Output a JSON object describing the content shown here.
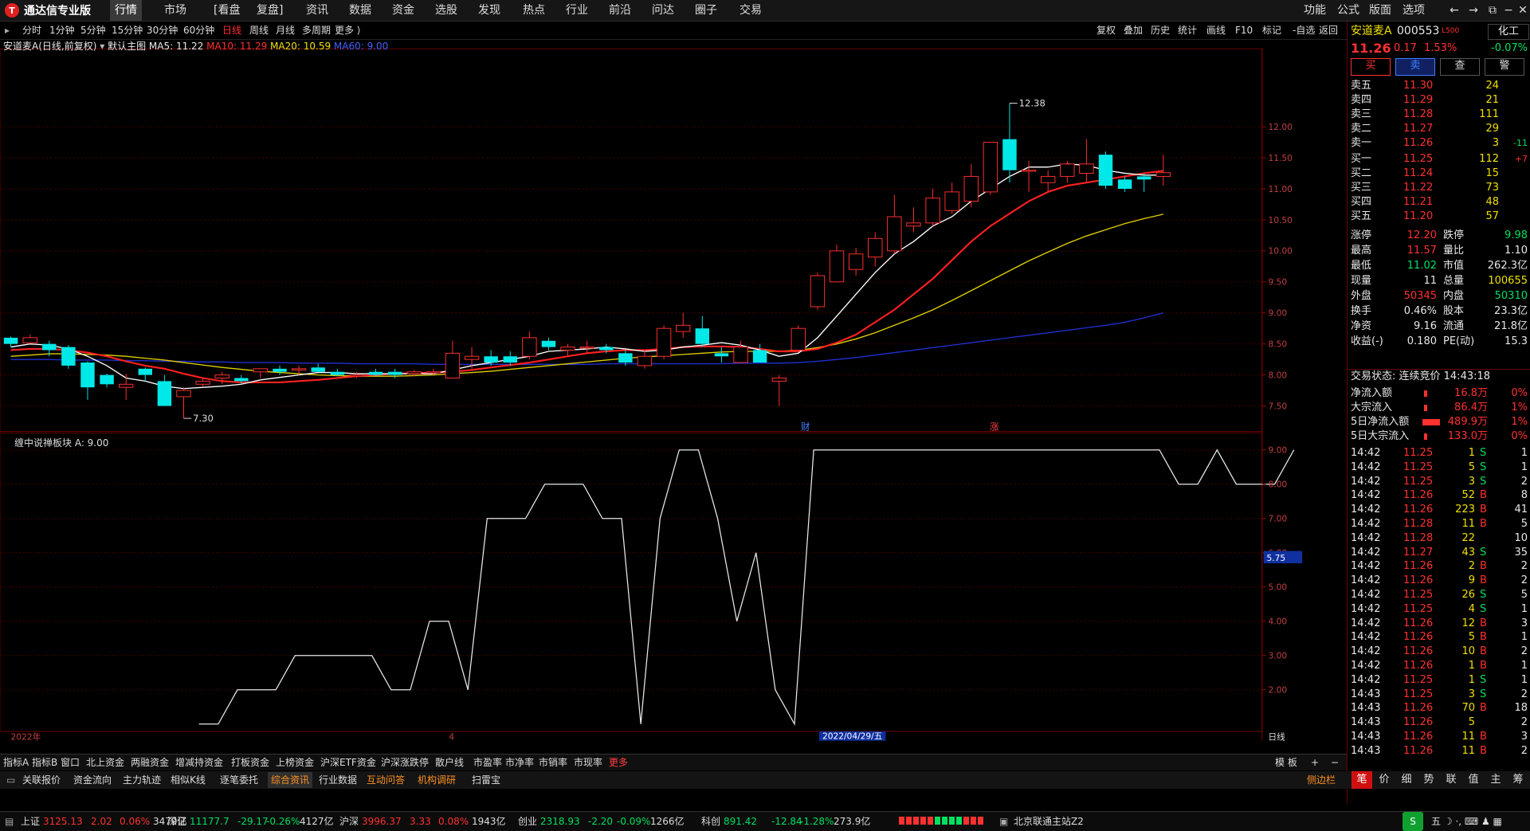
{
  "app": {
    "title": "通达信专业版"
  },
  "menu": [
    "行情",
    "市场",
    "[看盘",
    "复盘]",
    "资讯",
    "数据",
    "资金",
    "选股",
    "发现",
    "热点",
    "行业",
    "前沿",
    "问达",
    "圈子",
    "交易"
  ],
  "menu_right": [
    "功能",
    "公式",
    "版面",
    "选项"
  ],
  "periods": [
    "分时",
    "1分钟",
    "5分钟",
    "15分钟",
    "30分钟",
    "60分钟",
    "日线",
    "周线",
    "月线",
    "多周期",
    "更多"
  ],
  "selected_period": "日线",
  "toolbar": [
    "复权",
    "叠加",
    "历史",
    "统计",
    "画线",
    "F10",
    "标记",
    "-自选",
    "返回"
  ],
  "legend": {
    "stock": "安道麦A(日线,前复权)",
    "main": "默认主图",
    "ma5": "MA5: 11.22",
    "ma10": "MA10: 11.29",
    "ma20": "MA20: 10.59",
    "ma60": "MA60: 9.00"
  },
  "legend2": "缠中说禅板块 A: 9.00",
  "annotations": {
    "high": "12.38",
    "low": "7.30",
    "cai": "财",
    "zhang": "涨",
    "date": "2022/04/29/五",
    "year": "2022年",
    "month": "4",
    "period_label": "日线",
    "ind_value": "5.75"
  },
  "y_axis_price": [
    "12.00",
    "11.50",
    "11.00",
    "10.50",
    "10.00",
    "9.50",
    "9.00",
    "8.50",
    "8.00",
    "7.50"
  ],
  "y_axis_ind": [
    "9.00",
    "8.00",
    "7.00",
    "6.00",
    "5.00",
    "4.00",
    "3.00",
    "2.00"
  ],
  "chart_data": {
    "type": "candlestick",
    "price_range": [
      7.2,
      12.5
    ],
    "candles": [
      {
        "o": 8.6,
        "h": 8.62,
        "l": 8.45,
        "c": 8.5
      },
      {
        "o": 8.52,
        "h": 8.65,
        "l": 8.5,
        "c": 8.6
      },
      {
        "o": 8.5,
        "h": 8.55,
        "l": 8.3,
        "c": 8.4
      },
      {
        "o": 8.45,
        "h": 8.48,
        "l": 8.1,
        "c": 8.15
      },
      {
        "o": 8.2,
        "h": 8.22,
        "l": 7.6,
        "c": 7.8
      },
      {
        "o": 8.0,
        "h": 8.02,
        "l": 7.8,
        "c": 7.85
      },
      {
        "o": 7.8,
        "h": 8.02,
        "l": 7.6,
        "c": 7.85
      },
      {
        "o": 8.1,
        "h": 8.12,
        "l": 7.9,
        "c": 8.0
      },
      {
        "o": 7.9,
        "h": 8.0,
        "l": 7.5,
        "c": 7.5
      },
      {
        "o": 7.65,
        "h": 7.8,
        "l": 7.3,
        "c": 7.75
      },
      {
        "o": 7.85,
        "h": 7.95,
        "l": 7.8,
        "c": 7.9
      },
      {
        "o": 7.95,
        "h": 8.05,
        "l": 7.85,
        "c": 8.0
      },
      {
        "o": 7.95,
        "h": 8.0,
        "l": 7.85,
        "c": 7.9
      },
      {
        "o": 8.05,
        "h": 8.1,
        "l": 7.95,
        "c": 8.1
      },
      {
        "o": 8.1,
        "h": 8.15,
        "l": 8.0,
        "c": 8.05
      },
      {
        "o": 8.08,
        "h": 8.15,
        "l": 8.0,
        "c": 8.1
      },
      {
        "o": 8.12,
        "h": 8.18,
        "l": 8.05,
        "c": 8.05
      },
      {
        "o": 8.05,
        "h": 8.1,
        "l": 7.98,
        "c": 8.0
      },
      {
        "o": 8.0,
        "h": 8.05,
        "l": 7.95,
        "c": 8.0
      },
      {
        "o": 8.05,
        "h": 8.1,
        "l": 7.98,
        "c": 8.0
      },
      {
        "o": 8.05,
        "h": 8.1,
        "l": 7.95,
        "c": 8.0
      },
      {
        "o": 8.02,
        "h": 8.08,
        "l": 7.98,
        "c": 8.05
      },
      {
        "o": 8.05,
        "h": 8.1,
        "l": 8.0,
        "c": 8.05
      },
      {
        "o": 7.95,
        "h": 8.55,
        "l": 7.95,
        "c": 8.35
      },
      {
        "o": 8.25,
        "h": 8.45,
        "l": 8.1,
        "c": 8.3
      },
      {
        "o": 8.3,
        "h": 8.4,
        "l": 8.15,
        "c": 8.2
      },
      {
        "o": 8.3,
        "h": 8.38,
        "l": 8.15,
        "c": 8.2
      },
      {
        "o": 8.3,
        "h": 8.7,
        "l": 8.25,
        "c": 8.6
      },
      {
        "o": 8.55,
        "h": 8.6,
        "l": 8.4,
        "c": 8.45
      },
      {
        "o": 8.4,
        "h": 8.5,
        "l": 8.3,
        "c": 8.45
      },
      {
        "o": 8.45,
        "h": 8.55,
        "l": 8.35,
        "c": 8.45
      },
      {
        "o": 8.45,
        "h": 8.5,
        "l": 8.35,
        "c": 8.4
      },
      {
        "o": 8.35,
        "h": 8.4,
        "l": 8.15,
        "c": 8.2
      },
      {
        "o": 8.15,
        "h": 8.4,
        "l": 8.1,
        "c": 8.3
      },
      {
        "o": 8.3,
        "h": 8.8,
        "l": 8.25,
        "c": 8.75
      },
      {
        "o": 8.7,
        "h": 9.0,
        "l": 8.6,
        "c": 8.8
      },
      {
        "o": 8.75,
        "h": 8.95,
        "l": 8.45,
        "c": 8.5
      },
      {
        "o": 8.35,
        "h": 8.45,
        "l": 8.2,
        "c": 8.3
      },
      {
        "o": 8.2,
        "h": 8.55,
        "l": 8.2,
        "c": 8.45
      },
      {
        "o": 8.4,
        "h": 8.5,
        "l": 8.2,
        "c": 8.2
      },
      {
        "o": 7.9,
        "h": 8.0,
        "l": 7.5,
        "c": 7.95
      },
      {
        "o": 8.4,
        "h": 8.8,
        "l": 8.4,
        "c": 8.75
      },
      {
        "o": 9.1,
        "h": 9.65,
        "l": 9.05,
        "c": 9.6
      },
      {
        "o": 9.5,
        "h": 10.1,
        "l": 9.5,
        "c": 10.0
      },
      {
        "o": 9.7,
        "h": 10.05,
        "l": 9.6,
        "c": 9.95
      },
      {
        "o": 9.9,
        "h": 10.3,
        "l": 9.75,
        "c": 10.2
      },
      {
        "o": 10.0,
        "h": 10.9,
        "l": 9.95,
        "c": 10.55
      },
      {
        "o": 10.4,
        "h": 10.7,
        "l": 10.3,
        "c": 10.45
      },
      {
        "o": 10.45,
        "h": 11.0,
        "l": 10.4,
        "c": 10.85
      },
      {
        "o": 10.65,
        "h": 11.1,
        "l": 10.6,
        "c": 10.95
      },
      {
        "o": 10.8,
        "h": 11.4,
        "l": 10.7,
        "c": 11.2
      },
      {
        "o": 10.95,
        "h": 11.75,
        "l": 10.9,
        "c": 11.75
      },
      {
        "o": 11.8,
        "h": 12.38,
        "l": 11.1,
        "c": 11.3
      },
      {
        "o": 11.3,
        "h": 11.45,
        "l": 10.95,
        "c": 11.3
      },
      {
        "o": 11.1,
        "h": 11.3,
        "l": 10.95,
        "c": 11.2
      },
      {
        "o": 11.2,
        "h": 11.45,
        "l": 11.1,
        "c": 11.4
      },
      {
        "o": 11.25,
        "h": 11.8,
        "l": 11.1,
        "c": 11.4
      },
      {
        "o": 11.55,
        "h": 11.6,
        "l": 11.0,
        "c": 11.05
      },
      {
        "o": 11.15,
        "h": 11.2,
        "l": 10.95,
        "c": 11.0
      },
      {
        "o": 11.2,
        "h": 11.25,
        "l": 10.95,
        "c": 11.15
      },
      {
        "o": 11.2,
        "h": 11.55,
        "l": 11.05,
        "c": 11.26
      }
    ],
    "ma5": [
      8.45,
      8.5,
      8.48,
      8.42,
      8.3,
      8.15,
      7.95,
      7.9,
      7.82,
      7.78,
      7.8,
      7.82,
      7.85,
      7.92,
      7.96,
      8.0,
      8.04,
      8.04,
      8.02,
      8.02,
      8.02,
      8.02,
      8.02,
      8.08,
      8.15,
      8.2,
      8.25,
      8.3,
      8.38,
      8.4,
      8.42,
      8.45,
      8.42,
      8.38,
      8.4,
      8.45,
      8.48,
      8.52,
      8.48,
      8.4,
      8.3,
      8.35,
      8.6,
      8.95,
      9.3,
      9.65,
      9.95,
      10.15,
      10.4,
      10.55,
      10.8,
      11.0,
      11.2,
      11.35,
      11.35,
      11.4,
      11.38,
      11.3,
      11.25,
      11.22,
      11.22
    ],
    "ma10": [
      8.4,
      8.42,
      8.42,
      8.4,
      8.36,
      8.3,
      8.22,
      8.15,
      8.1,
      8.02,
      7.95,
      7.9,
      7.88,
      7.88,
      7.88,
      7.9,
      7.92,
      7.95,
      7.98,
      8.0,
      8.02,
      8.03,
      8.04,
      8.05,
      8.08,
      8.12,
      8.16,
      8.2,
      8.25,
      8.3,
      8.35,
      8.38,
      8.4,
      8.4,
      8.42,
      8.45,
      8.46,
      8.46,
      8.45,
      8.42,
      8.38,
      8.38,
      8.42,
      8.52,
      8.65,
      8.85,
      9.05,
      9.3,
      9.55,
      9.85,
      10.15,
      10.4,
      10.6,
      10.8,
      10.95,
      11.05,
      11.1,
      11.15,
      11.2,
      11.25,
      11.29
    ],
    "ma20": [
      8.3,
      8.32,
      8.34,
      8.34,
      8.33,
      8.32,
      8.3,
      8.27,
      8.24,
      8.2,
      8.16,
      8.12,
      8.09,
      8.06,
      8.04,
      8.02,
      8.0,
      7.99,
      7.98,
      7.98,
      7.98,
      7.99,
      8.0,
      8.02,
      8.04,
      8.06,
      8.09,
      8.12,
      8.15,
      8.18,
      8.21,
      8.24,
      8.27,
      8.29,
      8.31,
      8.33,
      8.35,
      8.37,
      8.38,
      8.38,
      8.38,
      8.4,
      8.44,
      8.5,
      8.58,
      8.68,
      8.8,
      8.92,
      9.05,
      9.2,
      9.36,
      9.52,
      9.68,
      9.84,
      9.98,
      10.12,
      10.24,
      10.34,
      10.44,
      10.52,
      10.59
    ],
    "ma60": [
      8.25,
      8.25,
      8.25,
      8.24,
      8.24,
      8.24,
      8.23,
      8.23,
      8.22,
      8.22,
      8.21,
      8.21,
      8.2,
      8.2,
      8.2,
      8.19,
      8.19,
      8.19,
      8.18,
      8.18,
      8.18,
      8.18,
      8.17,
      8.17,
      8.17,
      8.17,
      8.17,
      8.17,
      8.17,
      8.17,
      8.17,
      8.18,
      8.18,
      8.18,
      8.18,
      8.18,
      8.18,
      8.18,
      8.19,
      8.19,
      8.19,
      8.2,
      8.22,
      8.25,
      8.28,
      8.32,
      8.36,
      8.4,
      8.44,
      8.48,
      8.52,
      8.56,
      8.6,
      8.64,
      8.68,
      8.72,
      8.76,
      8.8,
      8.85,
      8.92,
      9.0
    ],
    "indicator": {
      "name": "缠中说禅板块 A",
      "range": [
        1.0,
        9.5
      ],
      "values": [
        1,
        1,
        2,
        2,
        2,
        3,
        3,
        3,
        3,
        3,
        2,
        2,
        4,
        4,
        2,
        7,
        7,
        7,
        8,
        8,
        8,
        7,
        7,
        1,
        7,
        9,
        9,
        7,
        4,
        6,
        2,
        1,
        9,
        9,
        9,
        9,
        9,
        9,
        9,
        9,
        9,
        9,
        9,
        9,
        9,
        9,
        9,
        9,
        9,
        9,
        9,
        8,
        8,
        9,
        8,
        8,
        8,
        9
      ]
    }
  },
  "quote": {
    "name": "安道麦A",
    "code": "000553",
    "tag": "L500",
    "btn": "化工",
    "price": "11.26",
    "change": "0.17",
    "pct": "1.53%",
    "sector_pct": "-0.07%",
    "actions": [
      "买",
      "卖",
      "查",
      "警"
    ],
    "sell": [
      {
        "label": "卖五",
        "price": "11.30",
        "vol": "24",
        "d": ""
      },
      {
        "label": "卖四",
        "price": "11.29",
        "vol": "21",
        "d": ""
      },
      {
        "label": "卖三",
        "price": "11.28",
        "vol": "111",
        "d": ""
      },
      {
        "label": "卖二",
        "price": "11.27",
        "vol": "29",
        "d": ""
      },
      {
        "label": "卖一",
        "price": "11.26",
        "vol": "3",
        "d": "-11"
      }
    ],
    "buy": [
      {
        "label": "买一",
        "price": "11.25",
        "vol": "112",
        "d": "+7"
      },
      {
        "label": "买二",
        "price": "11.24",
        "vol": "15",
        "d": ""
      },
      {
        "label": "买三",
        "price": "11.22",
        "vol": "73",
        "d": ""
      },
      {
        "label": "买四",
        "price": "11.21",
        "vol": "48",
        "d": ""
      },
      {
        "label": "买五",
        "price": "11.20",
        "vol": "57",
        "d": ""
      }
    ],
    "stats": [
      [
        "涨停",
        "12.20",
        "跌停",
        "9.98"
      ],
      [
        "最高",
        "11.57",
        "量比",
        "1.10"
      ],
      [
        "最低",
        "11.02",
        "市值",
        "262.3亿"
      ],
      [
        "现量",
        "11",
        "总量",
        "100655"
      ],
      [
        "外盘",
        "50345",
        "内盘",
        "50310"
      ],
      [
        "换手",
        "0.46%",
        "股本",
        "23.3亿"
      ],
      [
        "净资",
        "9.16",
        "流通",
        "21.8亿"
      ],
      [
        "收益(-)",
        "0.180",
        "PE(动)",
        "15.3"
      ]
    ],
    "trade_status": "交易状态: 连续竞价 14:43:18",
    "flows": [
      [
        "净流入额",
        "16.8万",
        "0%"
      ],
      [
        "大宗流入",
        "86.4万",
        "1%"
      ],
      [
        "5日净流入额",
        "489.9万",
        "1%"
      ],
      [
        "5日大宗流入",
        "133.0万",
        "0%"
      ]
    ],
    "ticks": [
      [
        "14:42",
        "11.25",
        "1",
        "S",
        "1"
      ],
      [
        "14:42",
        "11.25",
        "5",
        "S",
        "1"
      ],
      [
        "14:42",
        "11.25",
        "3",
        "S",
        "2"
      ],
      [
        "14:42",
        "11.26",
        "52",
        "B",
        "8"
      ],
      [
        "14:42",
        "11.26",
        "223",
        "B",
        "41"
      ],
      [
        "14:42",
        "11.28",
        "11",
        "B",
        "5"
      ],
      [
        "14:42",
        "11.28",
        "22",
        "",
        "10"
      ],
      [
        "14:42",
        "11.27",
        "43",
        "S",
        "35"
      ],
      [
        "14:42",
        "11.26",
        "2",
        "B",
        "2"
      ],
      [
        "14:42",
        "11.26",
        "9",
        "B",
        "2"
      ],
      [
        "14:42",
        "11.25",
        "26",
        "S",
        "5"
      ],
      [
        "14:42",
        "11.25",
        "4",
        "S",
        "1"
      ],
      [
        "14:42",
        "11.26",
        "12",
        "B",
        "3"
      ],
      [
        "14:42",
        "11.26",
        "5",
        "B",
        "1"
      ],
      [
        "14:42",
        "11.26",
        "10",
        "B",
        "2"
      ],
      [
        "14:42",
        "11.26",
        "1",
        "B",
        "1"
      ],
      [
        "14:42",
        "11.25",
        "1",
        "S",
        "1"
      ],
      [
        "14:43",
        "11.25",
        "3",
        "S",
        "2"
      ],
      [
        "14:43",
        "11.26",
        "70",
        "B",
        "18"
      ],
      [
        "14:43",
        "11.26",
        "5",
        "",
        "2"
      ],
      [
        "14:43",
        "11.26",
        "11",
        "B",
        "3"
      ],
      [
        "14:43",
        "11.26",
        "11",
        "B",
        "2"
      ]
    ]
  },
  "tabs1": [
    "指标A",
    "指标B",
    "窗口",
    "北上资金",
    "两融资金",
    "增减持资金",
    "打板资金",
    "上榜资金",
    "沪深ETF资金",
    "沪深涨跌停",
    "散户线",
    "市盈率",
    "市净率",
    "市销率",
    "市现率",
    "更多"
  ],
  "tabs1_right": "模 板",
  "tabs2": [
    "关联报价",
    "资金流向",
    "主力轨迹",
    "相似K线",
    "逐笔委托",
    "综合资讯",
    "行业数据",
    "互动问答",
    "机构调研",
    "扫雷宝"
  ],
  "tabs2_right": "侧边栏",
  "rtabs": [
    "笔",
    "价",
    "细",
    "势",
    "联",
    "值",
    "主",
    "筹"
  ],
  "status": [
    {
      "n": "上证",
      "v": "3125.13",
      "c": "2.02",
      "p": "0.06%",
      "a": "3479亿"
    },
    {
      "n": "深证",
      "v": "11177.7",
      "c": "-29.17",
      "p": "-0.26%",
      "a": "4127亿"
    },
    {
      "n": "沪深",
      "v": "3996.37",
      "c": "3.33",
      "p": "0.08%",
      "a": "1943亿"
    },
    {
      "n": "创业",
      "v": "2318.93",
      "c": "-2.20",
      "p": "-0.09%",
      "a": "1266亿"
    },
    {
      "n": "科创",
      "v": "891.42",
      "c": "-12.84",
      "p": "-1.28%",
      "a": "273.9亿"
    }
  ],
  "server": "北京联通主站Z2",
  "colors": {
    "up": "#ff3030",
    "down": "#00e0e0",
    "ma5": "#ffffff",
    "ma10": "#ff2020",
    "ma20": "#e0d000",
    "ma60": "#2030d0",
    "grid": "#5a0000"
  }
}
